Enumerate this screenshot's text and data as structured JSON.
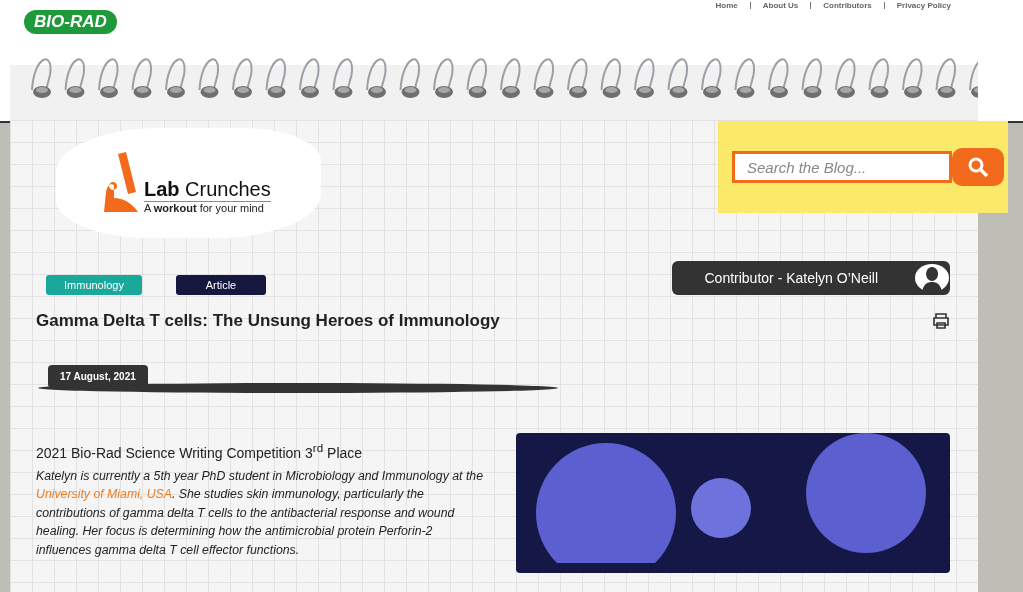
{
  "header": {
    "brand": "BIO-RAD",
    "nav": [
      {
        "label": "Home"
      },
      {
        "label": "About Us"
      },
      {
        "label": "Contributors"
      },
      {
        "label": "Privacy Policy"
      }
    ]
  },
  "blog_logo": {
    "name": "**Lab** Crunches",
    "tagline": "A **workout** for your mind"
  },
  "search": {
    "placeholder": "Search the Blog..."
  },
  "tags": [
    {
      "label": "Immunology",
      "color": "#1aa89a"
    },
    {
      "label": "Article",
      "color": "#15173f"
    }
  ],
  "contributor": {
    "label": "Contributor - Katelyn O’Neill"
  },
  "article": {
    "title": "Gamma Delta T cells: The Unsung Heroes of Immunology",
    "date": "17 August, 2021",
    "subtitle": "2021 Bio-Rad Science Writing Competition 3$^{rd}$ Place",
    "intro_before": "Katelyn is currently a 5th year PhD student in Microbiology and Immunology at the ",
    "intro_link": "University of Miami, USA",
    "intro_after": ". She studies skin immunology, particularly the contributions of gamma delta T cells to the antibacterial response and wound healing. Her focus is determining how the antimicrobial protein Perforin-2 influences gamma delta T cell effector functions."
  }
}
